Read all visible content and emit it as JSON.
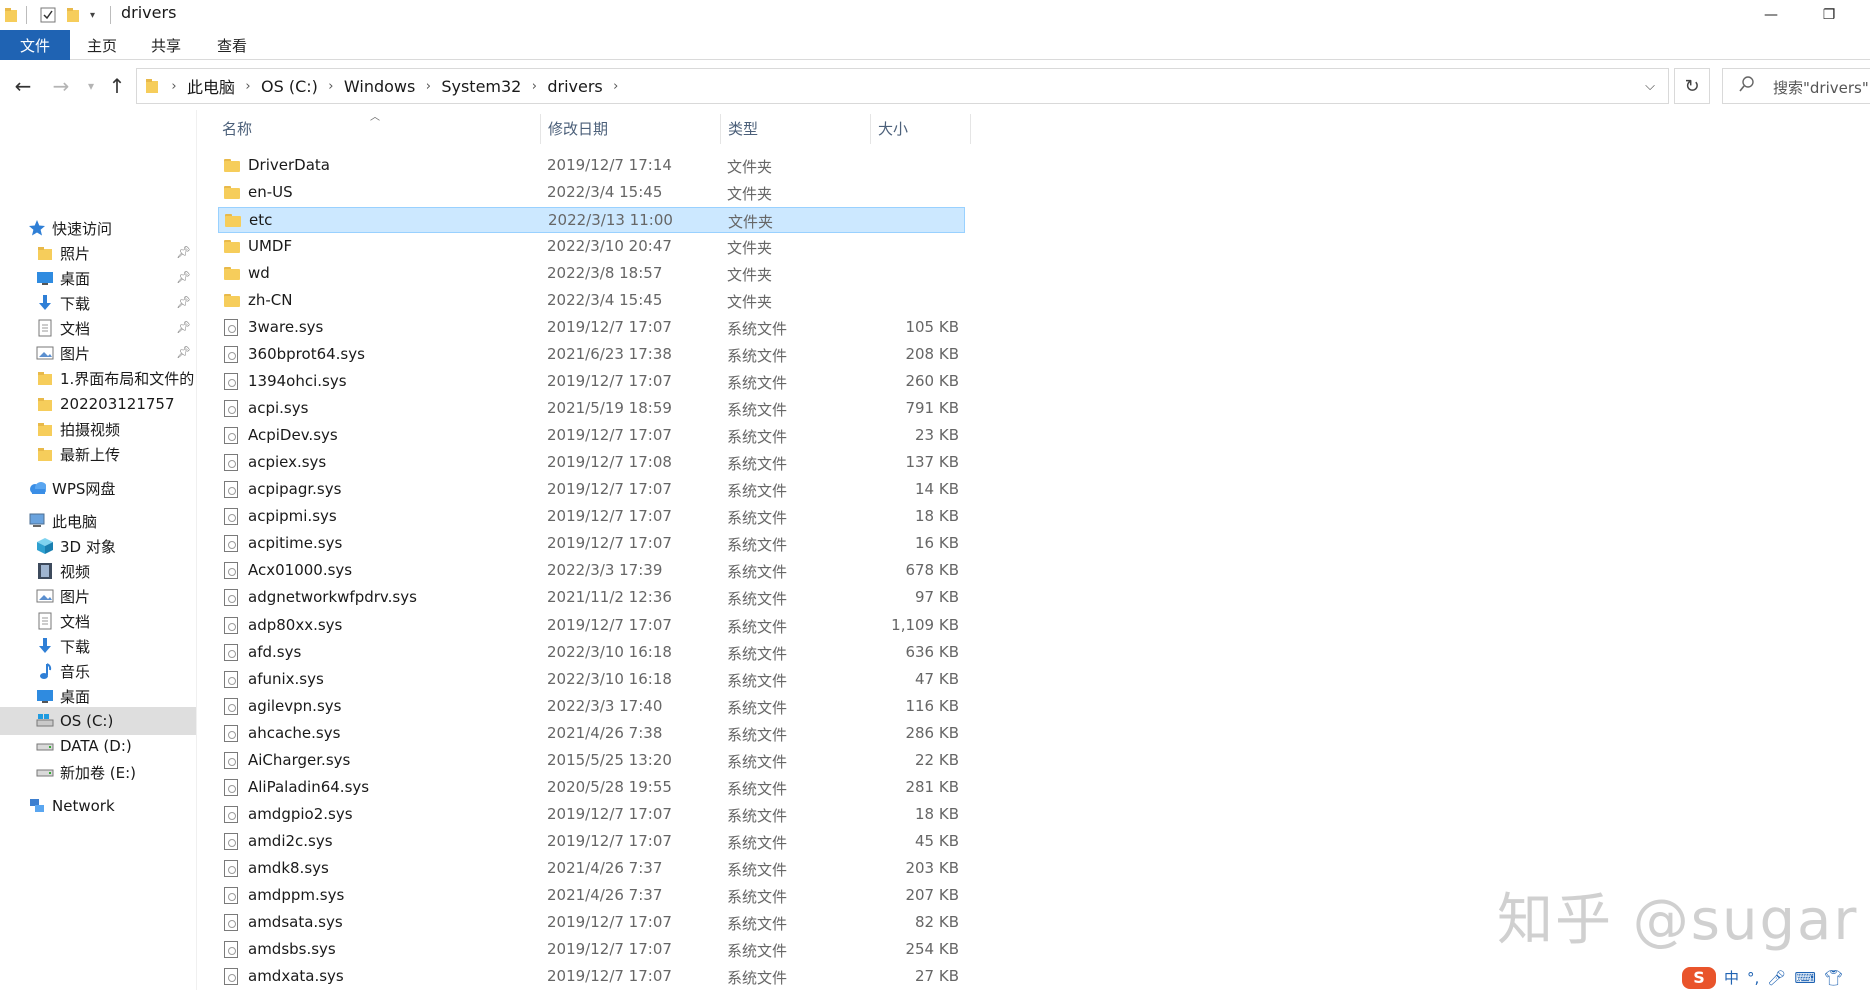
{
  "window": {
    "title": "drivers",
    "minimize_glyph": "—",
    "restore_glyph": "❐"
  },
  "ribbon": {
    "tabs": [
      "文件",
      "主页",
      "共享",
      "查看"
    ]
  },
  "address": {
    "crumbs": [
      "此电脑",
      "OS (C:)",
      "Windows",
      "System32",
      "drivers"
    ],
    "search_placeholder": "搜索\"drivers\""
  },
  "sidebar": {
    "items": [
      {
        "label": "快速访问",
        "icon": "star-icon",
        "pinned": false
      },
      {
        "label": "照片",
        "icon": "folder-icon",
        "pinned": true
      },
      {
        "label": "桌面",
        "icon": "desktop-icon",
        "pinned": true
      },
      {
        "label": "下载",
        "icon": "download-icon",
        "pinned": true
      },
      {
        "label": "文档",
        "icon": "document-icon",
        "pinned": true
      },
      {
        "label": "图片",
        "icon": "pictures-icon",
        "pinned": true
      },
      {
        "label": "1.界面布局和文件的",
        "icon": "folder-icon",
        "pinned": false
      },
      {
        "label": "202203121757",
        "icon": "folder-icon",
        "pinned": false
      },
      {
        "label": "拍摄视频",
        "icon": "folder-icon",
        "pinned": false
      },
      {
        "label": "最新上传",
        "icon": "folder-icon",
        "pinned": false
      },
      {
        "label": "WPS网盘",
        "icon": "cloud-icon",
        "pinned": false
      },
      {
        "label": "此电脑",
        "icon": "computer-icon",
        "pinned": false
      },
      {
        "label": "3D 对象",
        "icon": "cube-icon",
        "pinned": false
      },
      {
        "label": "视频",
        "icon": "video-icon",
        "pinned": false
      },
      {
        "label": "图片",
        "icon": "pictures-icon",
        "pinned": false
      },
      {
        "label": "文档",
        "icon": "document-icon",
        "pinned": false
      },
      {
        "label": "下载",
        "icon": "download-icon",
        "pinned": false
      },
      {
        "label": "音乐",
        "icon": "music-icon",
        "pinned": false
      },
      {
        "label": "桌面",
        "icon": "desktop-icon",
        "pinned": false
      },
      {
        "label": "OS (C:)",
        "icon": "os-drive-icon",
        "pinned": false,
        "selected": true
      },
      {
        "label": "DATA (D:)",
        "icon": "drive-icon",
        "pinned": false
      },
      {
        "label": "新加卷 (E:)",
        "icon": "drive-icon",
        "pinned": false
      },
      {
        "label": "Network",
        "icon": "network-icon",
        "pinned": false
      }
    ]
  },
  "columns": {
    "name": "名称",
    "date": "修改日期",
    "type": "类型",
    "size": "大小"
  },
  "files": [
    {
      "name": "DriverData",
      "date": "2019/12/7 17:14",
      "type": "文件夹",
      "size": "",
      "kind": "folder"
    },
    {
      "name": "en-US",
      "date": "2022/3/4 15:45",
      "type": "文件夹",
      "size": "",
      "kind": "folder"
    },
    {
      "name": "etc",
      "date": "2022/3/13 11:00",
      "type": "文件夹",
      "size": "",
      "kind": "folder",
      "selected": true
    },
    {
      "name": "UMDF",
      "date": "2022/3/10 20:47",
      "type": "文件夹",
      "size": "",
      "kind": "folder"
    },
    {
      "name": "wd",
      "date": "2022/3/8 18:57",
      "type": "文件夹",
      "size": "",
      "kind": "folder"
    },
    {
      "name": "zh-CN",
      "date": "2022/3/4 15:45",
      "type": "文件夹",
      "size": "",
      "kind": "folder"
    },
    {
      "name": "3ware.sys",
      "date": "2019/12/7 17:07",
      "type": "系统文件",
      "size": "105 KB",
      "kind": "sys"
    },
    {
      "name": "360bprot64.sys",
      "date": "2021/6/23 17:38",
      "type": "系统文件",
      "size": "208 KB",
      "kind": "sys"
    },
    {
      "name": "1394ohci.sys",
      "date": "2019/12/7 17:07",
      "type": "系统文件",
      "size": "260 KB",
      "kind": "sys"
    },
    {
      "name": "acpi.sys",
      "date": "2021/5/19 18:59",
      "type": "系统文件",
      "size": "791 KB",
      "kind": "sys"
    },
    {
      "name": "AcpiDev.sys",
      "date": "2019/12/7 17:07",
      "type": "系统文件",
      "size": "23 KB",
      "kind": "sys"
    },
    {
      "name": "acpiex.sys",
      "date": "2019/12/7 17:08",
      "type": "系统文件",
      "size": "137 KB",
      "kind": "sys"
    },
    {
      "name": "acpipagr.sys",
      "date": "2019/12/7 17:07",
      "type": "系统文件",
      "size": "14 KB",
      "kind": "sys"
    },
    {
      "name": "acpipmi.sys",
      "date": "2019/12/7 17:07",
      "type": "系统文件",
      "size": "18 KB",
      "kind": "sys"
    },
    {
      "name": "acpitime.sys",
      "date": "2019/12/7 17:07",
      "type": "系统文件",
      "size": "16 KB",
      "kind": "sys"
    },
    {
      "name": "Acx01000.sys",
      "date": "2022/3/3 17:39",
      "type": "系统文件",
      "size": "678 KB",
      "kind": "sys"
    },
    {
      "name": "adgnetworkwfpdrv.sys",
      "date": "2021/11/2 12:36",
      "type": "系统文件",
      "size": "97 KB",
      "kind": "sys"
    },
    {
      "name": "adp80xx.sys",
      "date": "2019/12/7 17:07",
      "type": "系统文件",
      "size": "1,109 KB",
      "kind": "sys"
    },
    {
      "name": "afd.sys",
      "date": "2022/3/10 16:18",
      "type": "系统文件",
      "size": "636 KB",
      "kind": "sys"
    },
    {
      "name": "afunix.sys",
      "date": "2022/3/10 16:18",
      "type": "系统文件",
      "size": "47 KB",
      "kind": "sys"
    },
    {
      "name": "agilevpn.sys",
      "date": "2022/3/3 17:40",
      "type": "系统文件",
      "size": "116 KB",
      "kind": "sys"
    },
    {
      "name": "ahcache.sys",
      "date": "2021/4/26 7:38",
      "type": "系统文件",
      "size": "286 KB",
      "kind": "sys"
    },
    {
      "name": "AiCharger.sys",
      "date": "2015/5/25 13:20",
      "type": "系统文件",
      "size": "22 KB",
      "kind": "sys"
    },
    {
      "name": "AliPaladin64.sys",
      "date": "2020/5/28 19:55",
      "type": "系统文件",
      "size": "281 KB",
      "kind": "sys"
    },
    {
      "name": "amdgpio2.sys",
      "date": "2019/12/7 17:07",
      "type": "系统文件",
      "size": "18 KB",
      "kind": "sys"
    },
    {
      "name": "amdi2c.sys",
      "date": "2019/12/7 17:07",
      "type": "系统文件",
      "size": "45 KB",
      "kind": "sys"
    },
    {
      "name": "amdk8.sys",
      "date": "2021/4/26 7:37",
      "type": "系统文件",
      "size": "203 KB",
      "kind": "sys"
    },
    {
      "name": "amdppm.sys",
      "date": "2021/4/26 7:37",
      "type": "系统文件",
      "size": "207 KB",
      "kind": "sys"
    },
    {
      "name": "amdsata.sys",
      "date": "2019/12/7 17:07",
      "type": "系统文件",
      "size": "82 KB",
      "kind": "sys"
    },
    {
      "name": "amdsbs.sys",
      "date": "2019/12/7 17:07",
      "type": "系统文件",
      "size": "254 KB",
      "kind": "sys"
    },
    {
      "name": "amdxata.sys",
      "date": "2019/12/7 17:07",
      "type": "系统文件",
      "size": "27 KB",
      "kind": "sys"
    }
  ],
  "watermark": "知乎 @sugar",
  "ime": {
    "logo": "S",
    "mode": "中",
    "punct": "°,"
  },
  "colors": {
    "file_tab": "#1f63b3",
    "selection": "#cce8ff",
    "selection_border": "#99d1ff",
    "sidebar_selected": "#dedede",
    "folder": "#f6cd5b"
  }
}
